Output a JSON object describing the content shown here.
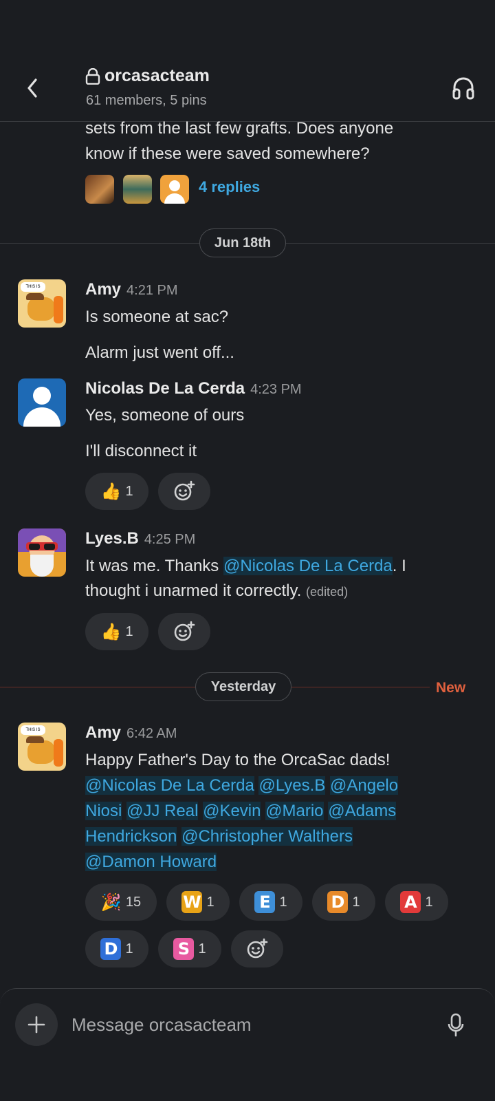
{
  "header": {
    "channel": "orcasacteam",
    "subtitle": "61 members, 5 pins"
  },
  "thread_preview": {
    "line1": "sets from the last few grafts. Does anyone",
    "line2": "know if these were saved somewhere?",
    "replies": "4 replies"
  },
  "dividers": {
    "first": "Jun 18th",
    "second": "Yesterday",
    "new_label": "New"
  },
  "messages": [
    {
      "name": "Amy",
      "time": "4:21 PM",
      "lines": [
        "Is someone at sac?",
        "Alarm just went off..."
      ]
    },
    {
      "name": "Nicolas De La Cerda",
      "time": "4:23 PM",
      "lines": [
        "Yes, someone of ours",
        "I'll disconnect it"
      ],
      "reaction_count": "1"
    },
    {
      "name": "Lyes.B",
      "time": "4:25 PM",
      "line1_pre": "It was me. Thanks ",
      "mention": "@Nicolas De La Cerda",
      "line1_post": ". I",
      "line2": "thought i unarmed it correctly.",
      "edited": "(edited)",
      "reaction_count": "1"
    },
    {
      "name": "Amy",
      "time": "6:42 AM",
      "line1": "Happy Father's Day to the OrcaSac dads!",
      "mentions": [
        "@Nicolas De La Cerda",
        "@Lyes.B",
        "@Angelo",
        "Niosi",
        "@JJ Real",
        "@Kevin",
        "@Mario",
        "@Adams",
        "Hendrickson",
        "@Christopher Walthers",
        "@Damon Howard"
      ],
      "reactions": [
        {
          "icon": "party-popper",
          "count": "15"
        },
        {
          "icon": "W",
          "count": "1",
          "color": "#e8a317"
        },
        {
          "icon": "E",
          "count": "1",
          "color": "#3e8fd8"
        },
        {
          "icon": "D",
          "count": "1",
          "color": "#e88a2a"
        },
        {
          "icon": "A",
          "count": "1",
          "color": "#e23a3a"
        },
        {
          "icon": "D",
          "count": "1",
          "color": "#2f6fd8"
        },
        {
          "icon": "S",
          "count": "1",
          "color": "#e85aa0"
        }
      ]
    }
  ],
  "composer": {
    "placeholder": "Message orcasacteam"
  }
}
